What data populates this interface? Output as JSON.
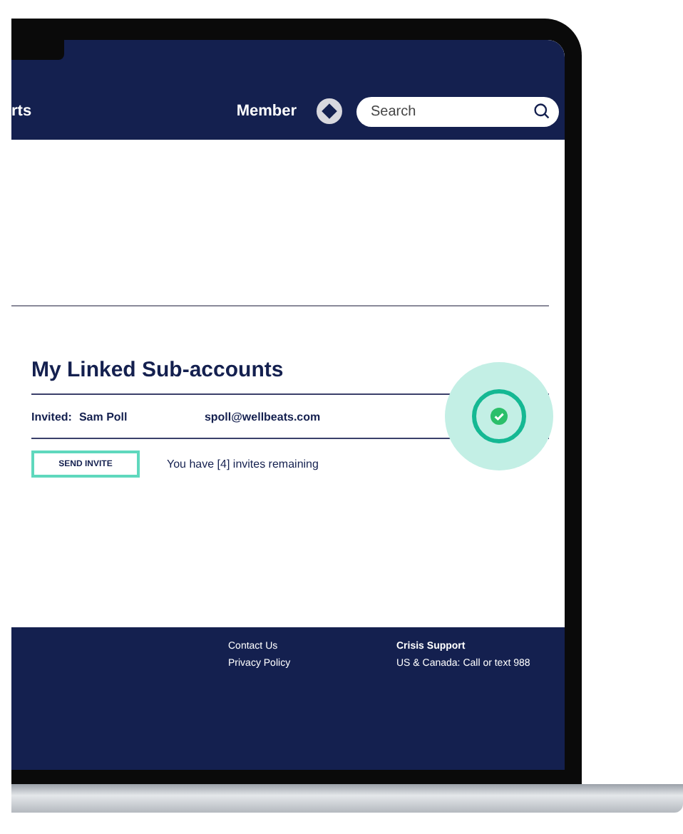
{
  "header": {
    "nav_partial": "rts",
    "member_label": "Member",
    "search": {
      "placeholder": "Search"
    }
  },
  "linked_accounts": {
    "title": "My Linked Sub-accounts",
    "invites": [
      {
        "status_label": "Invited:",
        "name": "Sam Poll",
        "email": "spoll@wellbeats.com",
        "confirmed": true
      }
    ],
    "send_button": "SEND INVITE",
    "remaining_text": "You have [4] invites remaining"
  },
  "footer": {
    "links": [
      "Contact Us",
      "Privacy Policy"
    ],
    "crisis": {
      "title": "Crisis Support",
      "line": "US & Canada: Call or text 988"
    }
  }
}
